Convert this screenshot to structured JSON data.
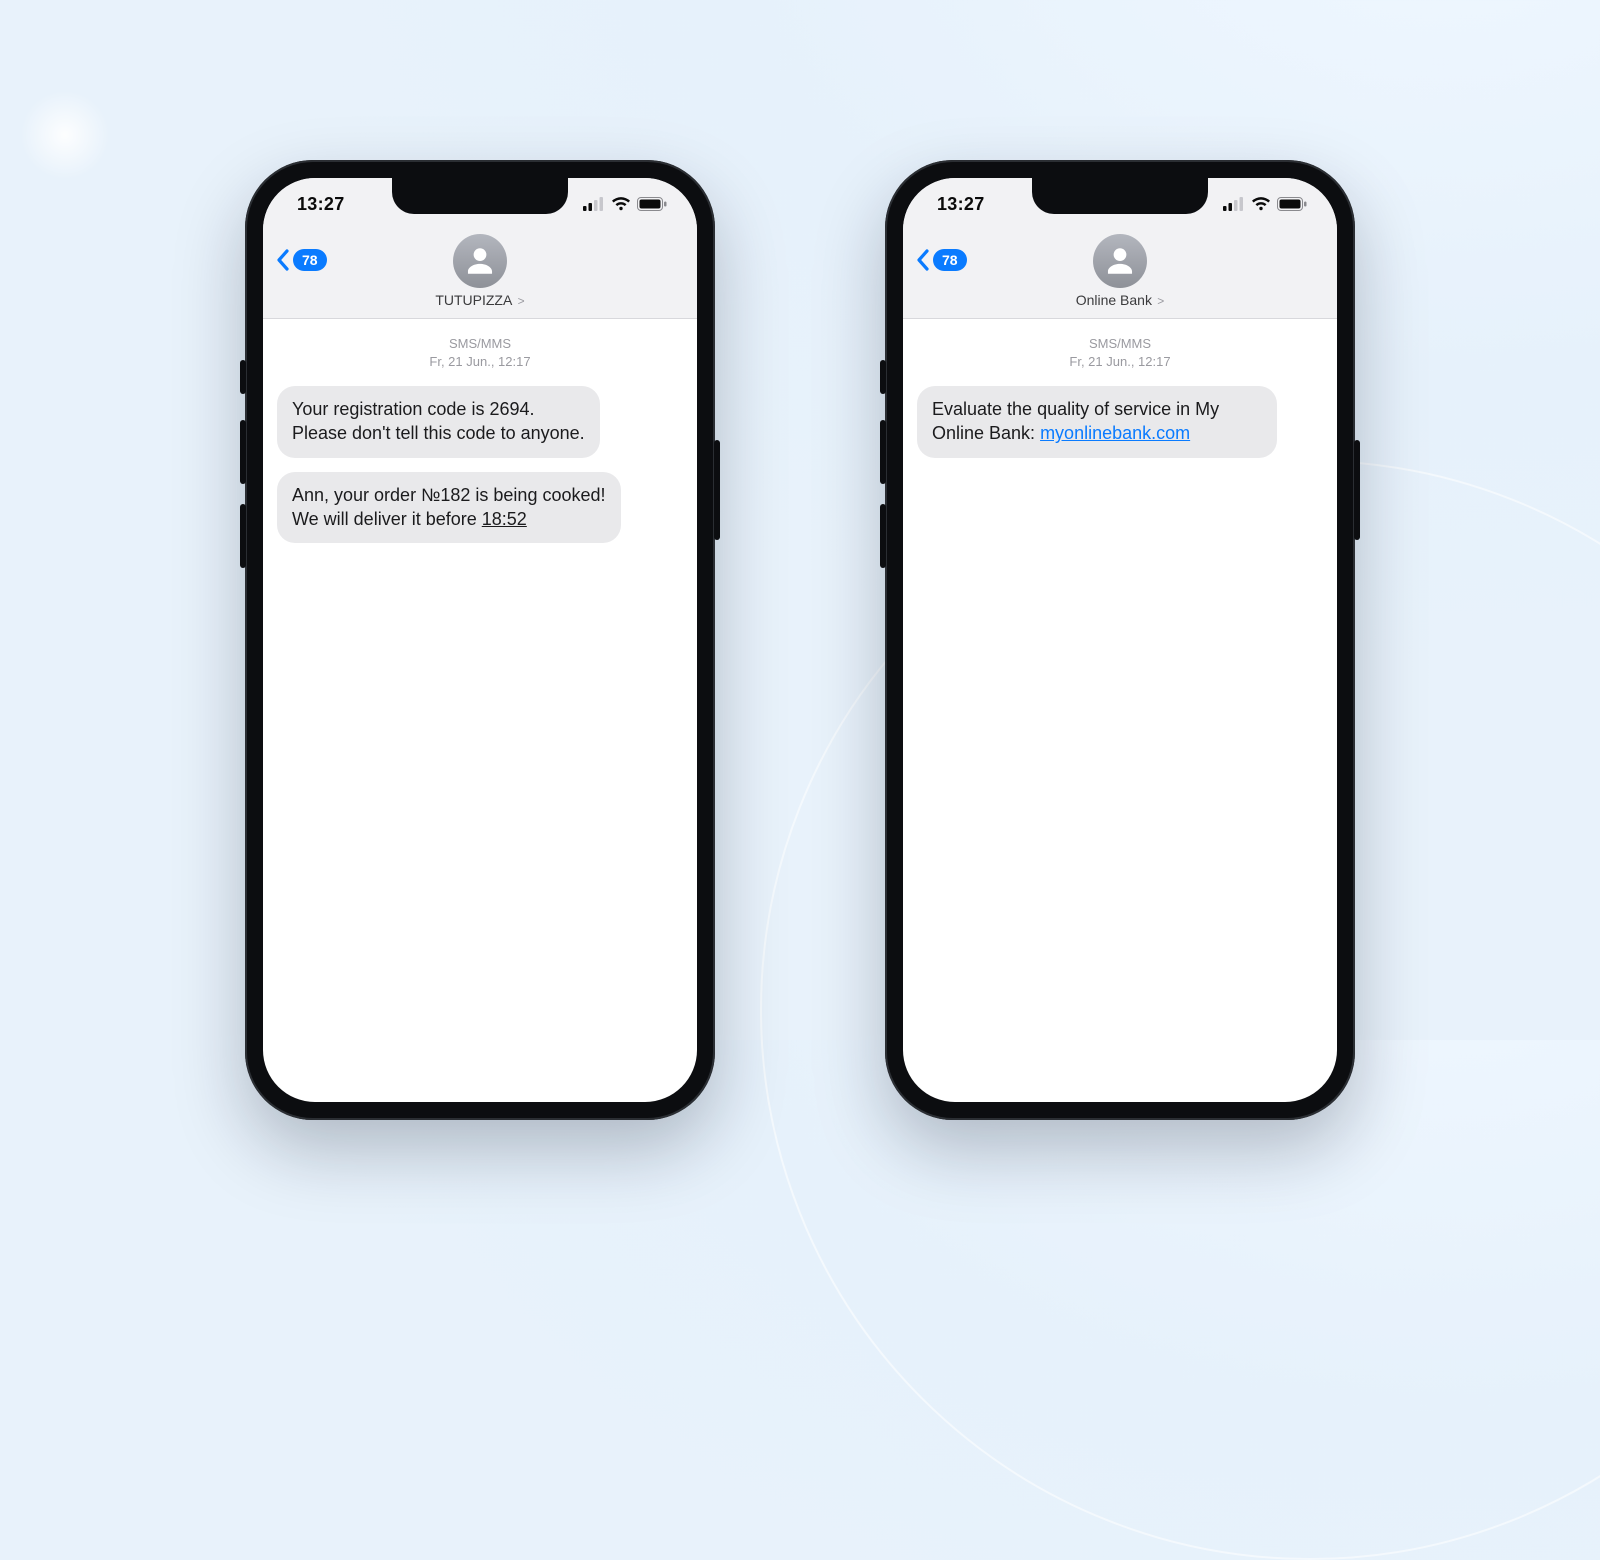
{
  "statusbar": {
    "time": "13:27"
  },
  "back_badge": "78",
  "meta": {
    "label": "SMS/MMS",
    "timestamp": "Fr, 21 Jun., 12:17"
  },
  "phones": [
    {
      "contact": "TUTUPIZZA",
      "messages": [
        {
          "line1": "Your registration code is 2694.",
          "line2": "Please don't tell this code to anyone."
        },
        {
          "line1": "Ann, your order №182 is being cooked!",
          "line2_prefix": "We will deliver it before ",
          "line2_time": "18:52"
        }
      ]
    },
    {
      "contact": "Online Bank",
      "messages": [
        {
          "text_prefix": "Evaluate the quality of service in My Online Bank: ",
          "link": "myonlinebank.com"
        }
      ]
    }
  ]
}
